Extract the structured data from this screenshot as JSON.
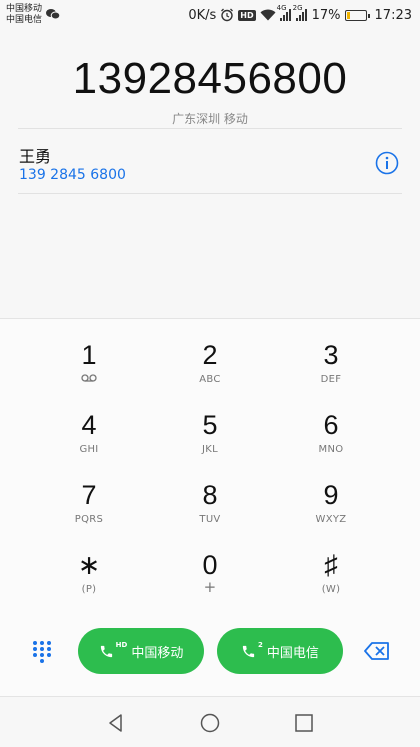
{
  "status_bar": {
    "carrier_1": "中国移动",
    "carrier_2": "中国电信",
    "net_speed": "0K/s",
    "hd": "HD",
    "net_1": "4G",
    "net_2": "2G",
    "battery_text": "17%",
    "battery_level": 0.17,
    "time": "17:23"
  },
  "display": {
    "number": "13928456800",
    "location": "广东深圳 移动"
  },
  "contact": {
    "name": "王勇",
    "number": "139 2845 6800"
  },
  "keypad": {
    "keys": [
      {
        "digit": "1",
        "sub": ""
      },
      {
        "digit": "2",
        "sub": "ABC"
      },
      {
        "digit": "3",
        "sub": "DEF"
      },
      {
        "digit": "4",
        "sub": "GHI"
      },
      {
        "digit": "5",
        "sub": "JKL"
      },
      {
        "digit": "6",
        "sub": "MNO"
      },
      {
        "digit": "7",
        "sub": "PQRS"
      },
      {
        "digit": "8",
        "sub": "TUV"
      },
      {
        "digit": "9",
        "sub": "WXYZ"
      },
      {
        "digit": "∗",
        "sub": "(P)"
      },
      {
        "digit": "0",
        "sub": "+"
      },
      {
        "digit": "♯",
        "sub": "(W)"
      }
    ]
  },
  "call_bar": {
    "sim1": {
      "badge": "HD",
      "label": "中国移动"
    },
    "sim2": {
      "badge": "2",
      "label": "中国电信"
    }
  },
  "colors": {
    "accent_blue": "#1a73e8",
    "call_green": "#2dbd4e"
  }
}
